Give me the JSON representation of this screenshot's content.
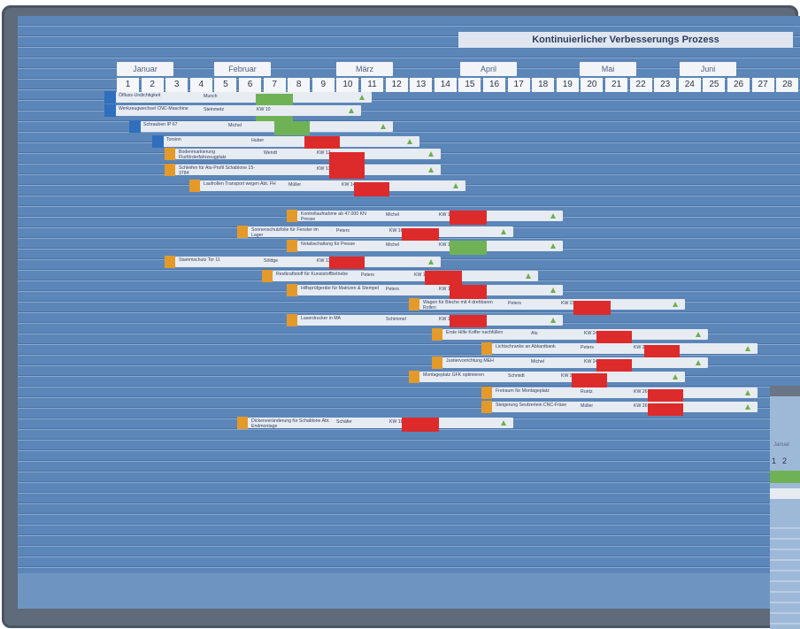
{
  "board": {
    "title": "Kontinuierlicher Verbesserungs Prozess",
    "months": [
      "Januar",
      "Februar",
      "März",
      "April",
      "Mai",
      "Juni"
    ],
    "weeks": [
      "1",
      "2",
      "3",
      "4",
      "5",
      "6",
      "7",
      "8",
      "9",
      "10",
      "11",
      "12",
      "13",
      "14",
      "15",
      "16",
      "17",
      "18",
      "19",
      "20",
      "21",
      "22",
      "23",
      "24",
      "25",
      "26",
      "27",
      "28"
    ]
  },
  "tasks": [
    {
      "title": "Ölfluss-Undichtigkeit",
      "person": "Munch",
      "week": "KW 10"
    },
    {
      "title": "Werkzeugwechsel CNC-Maschine",
      "person": "Steinmetz",
      "week": "KW 10"
    },
    {
      "title": "Schrauben IP 67",
      "person": "Michel",
      "week": "KW 11"
    },
    {
      "title": "Torsion",
      "person": "Huber",
      "week": "KW 12"
    },
    {
      "title": "Bodenmarkierung Flurförderfahrzeugplatz",
      "person": "Wendt",
      "week": "KW 12"
    },
    {
      "title": "Schleifen für Alu-Profil Schablone 15-3784",
      "person": "",
      "week": "KW 13"
    },
    {
      "title": "Laufrollen Transport wegen Abt. FH",
      "person": "Müller",
      "week": "KW 14"
    },
    {
      "title": "Kontrollaufnahme ab 47.000 KN Presse",
      "person": "Michel",
      "week": "KW 18"
    },
    {
      "title": "Sonnenschutzfolie für Fenster im Lager",
      "person": "Peters",
      "week": "KW 16"
    },
    {
      "title": "Notabschaltung für Presse",
      "person": "Michel",
      "week": "KW 18"
    },
    {
      "title": "Stammschutz Tor 11",
      "person": "Söldge",
      "week": "KW 13"
    },
    {
      "title": "Restkraftstoff für Kunststoffbetriebe",
      "person": "Peters",
      "week": "KW 17"
    },
    {
      "title": "Hilfsprüfgeräte für Matrizen & Stempel",
      "person": "Peters",
      "week": "KW 18"
    },
    {
      "title": "Wagen für Bleche mit 4 drehbaren Rollen",
      "person": "Peters",
      "week": "KW 23"
    },
    {
      "title": "Laserdrucker in MA",
      "person": "Schimmel",
      "week": "KW 18"
    },
    {
      "title": "Erste Hilfe Koffer nachfüllen",
      "person": "Alu",
      "week": "KW 24"
    },
    {
      "title": "Lichtschranke an Abkantbank",
      "person": "Peters",
      "week": "KW 26"
    },
    {
      "title": "Justiervorrichtung MEH",
      "person": "Michel",
      "week": "KW 24"
    },
    {
      "title": "Montageplatz GFK optimieren",
      "person": "Schmidt",
      "week": "KW 23"
    },
    {
      "title": "Freiraum für Montageplatz",
      "person": "Runtz",
      "week": "KW 26"
    },
    {
      "title": "Steigerung Seufzerlein CNC-Fräse",
      "person": "Müller",
      "week": "KW 26"
    },
    {
      "title": "Dickenveränderung für Schablone Abt. Endmontage",
      "person": "Schäfer",
      "week": "KW 16"
    }
  ],
  "second_board": {
    "month": "Januar",
    "weeks": [
      "1",
      "2"
    ]
  },
  "colors": {
    "board": "#5c86b8",
    "strip": "#e7ebf2",
    "red": "#dd2b2b",
    "green": "#6fb255",
    "orange": "#e39a2a",
    "blue": "#2f6fbd"
  }
}
